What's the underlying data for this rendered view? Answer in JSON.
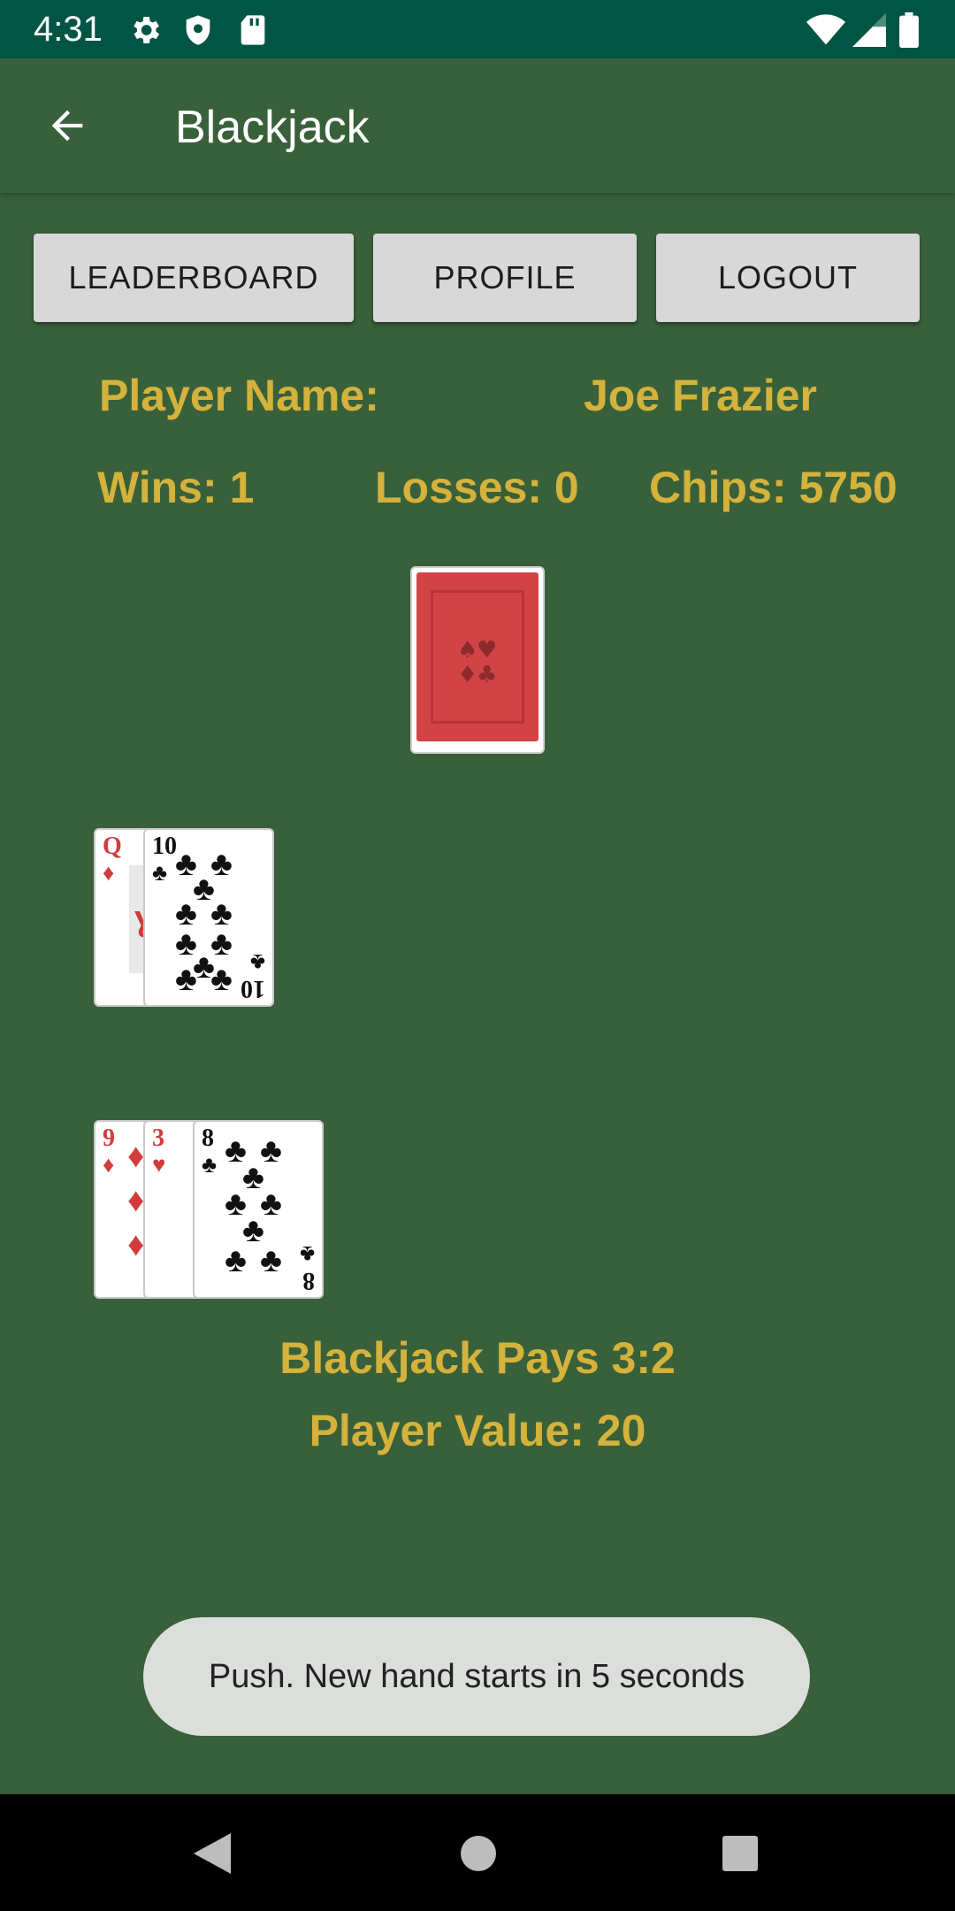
{
  "status_bar": {
    "time": "4:31"
  },
  "app_bar": {
    "title": "Blackjack"
  },
  "buttons": {
    "leaderboard": "Leaderboard",
    "profile": "Profile",
    "logout": "Logout"
  },
  "player": {
    "name_label": "Player Name:",
    "name_value": "Joe Frazier",
    "wins_label": "Wins:",
    "wins_value": "1",
    "losses_label": "Losses:",
    "losses_value": "0",
    "chips_label": "Chips:",
    "chips_value": "5750"
  },
  "dealer_hand": {
    "cards": [
      "Q♦",
      "10♣"
    ]
  },
  "player_hand": {
    "cards": [
      "9♦",
      "3♥",
      "8♣"
    ]
  },
  "info": {
    "pays": "Blackjack Pays 3:2",
    "value_label": "Player Value:",
    "value": "20"
  },
  "toast": {
    "message": "Push. New hand starts in 5 seconds"
  },
  "colors": {
    "felt": "#38603a",
    "status_bar": "#005545",
    "gold_text": "#d4b23c",
    "card_red": "#d23b3b"
  }
}
